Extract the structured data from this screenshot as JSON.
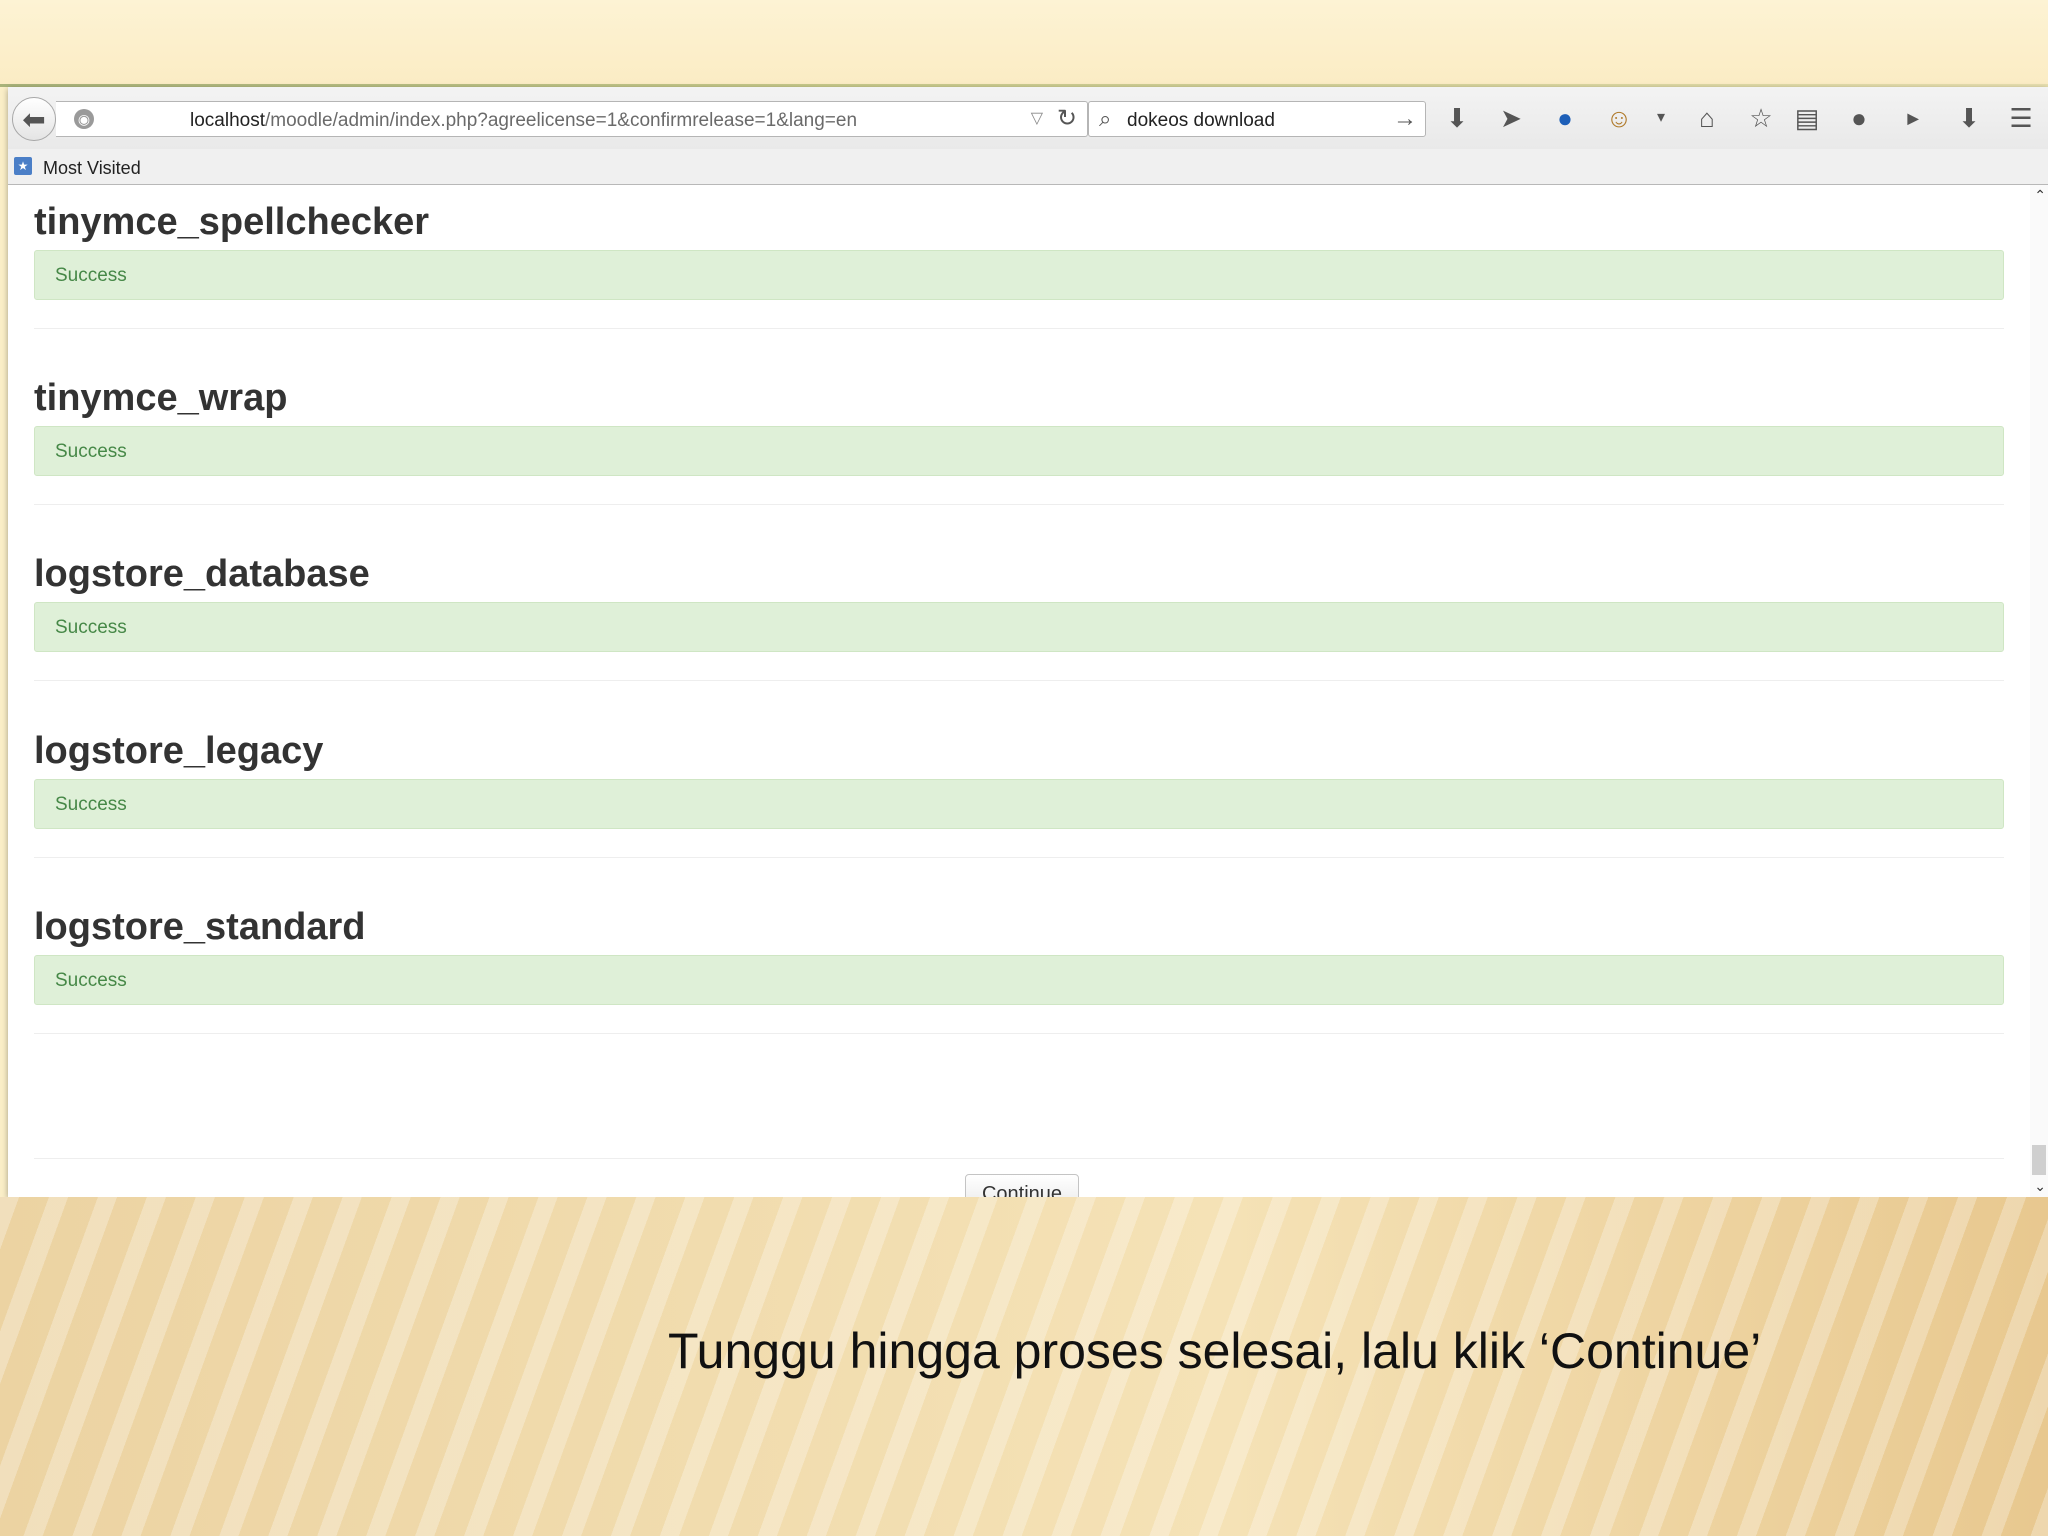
{
  "browser": {
    "url_host": "localhost",
    "url_path": "/moodle/admin/index.php?agreelicense=1&confirmrelease=1&lang=en",
    "search_value": "dokeos download",
    "bookmarks": [
      {
        "label": "Most Visited"
      }
    ],
    "toolbar_icons": [
      "download-icon",
      "send-icon",
      "sync-icon",
      "monkey-icon",
      "dropdown-icon",
      "home-icon",
      "star-icon",
      "reading-list-icon",
      "chat-icon",
      "youtube-icon",
      "save-icon",
      "menu-icon"
    ]
  },
  "page": {
    "sections": [
      {
        "title": "tinymce_spellchecker",
        "status": "Success"
      },
      {
        "title": "tinymce_wrap",
        "status": "Success"
      },
      {
        "title": "logstore_database",
        "status": "Success"
      },
      {
        "title": "logstore_legacy",
        "status": "Success"
      },
      {
        "title": "logstore_standard",
        "status": "Success"
      }
    ],
    "continue_label": "Continue"
  },
  "slide": {
    "caption": "Tunggu hingga proses selesai, lalu klik ‘Continue’"
  },
  "colors": {
    "success_bg": "#dff0d8",
    "success_text": "#468847",
    "slide_bg": "#fbefc8"
  }
}
